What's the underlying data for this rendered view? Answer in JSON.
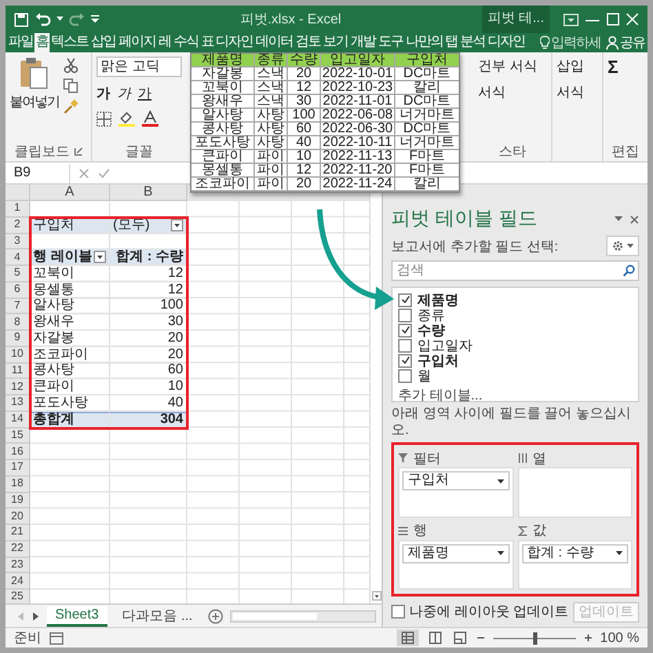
{
  "window": {
    "title": "피벗.xlsx - Excel",
    "context_tab": "피벗 테..."
  },
  "ribbon_tabs": [
    {
      "label": "파일",
      "selected": false
    },
    {
      "label": "홈",
      "selected": true
    },
    {
      "label": "텍스트",
      "selected": false
    },
    {
      "label": "삽입",
      "selected": false
    },
    {
      "label": "페이지 레",
      "selected": false
    },
    {
      "label": "수식",
      "selected": false
    },
    {
      "label": "표 디자인",
      "selected": false
    },
    {
      "label": "데이터",
      "selected": false
    },
    {
      "label": "검토",
      "selected": false
    },
    {
      "label": "보기",
      "selected": false
    },
    {
      "label": "개발 도구",
      "selected": false
    },
    {
      "label": "나만의 탭",
      "selected": false
    },
    {
      "label": "분석",
      "selected": false
    },
    {
      "label": "디자인",
      "selected": false
    }
  ],
  "tell_me": {
    "placeholder": "입력하세"
  },
  "share": "공유",
  "ribbon": {
    "clipboard": {
      "paste": "붙여넣기",
      "label": "클립보드"
    },
    "font": {
      "name": "맑은 고딕",
      "bold": "가",
      "italic": "가",
      "underline": "가",
      "label": "글꼴"
    },
    "styles": {
      "conditional": "건부 서식",
      "format": "서식",
      "label": "스타"
    },
    "cells": {
      "insert": "삽입",
      "format": "서식"
    },
    "editing": {
      "sum": "Σ",
      "label": "편집"
    }
  },
  "formula_bar": {
    "name_box": "B9"
  },
  "columns": [
    "A",
    "B"
  ],
  "sheet_rows": [
    {
      "num": "1"
    },
    {
      "num": "2",
      "kind": "filter",
      "a": "구입처",
      "b": "(모두)"
    },
    {
      "num": "3"
    },
    {
      "num": "4",
      "kind": "header",
      "a": "행 레이블",
      "b": "합계 : 수량"
    },
    {
      "num": "5",
      "kind": "item",
      "a": "꼬북이",
      "b": "12"
    },
    {
      "num": "6",
      "kind": "item",
      "a": "몽셀통",
      "b": "12"
    },
    {
      "num": "7",
      "kind": "item",
      "a": "알사탕",
      "b": "100"
    },
    {
      "num": "8",
      "kind": "item",
      "a": "왕새우",
      "b": "30"
    },
    {
      "num": "9",
      "kind": "item",
      "a": "자갈봉",
      "b": "20"
    },
    {
      "num": "10",
      "kind": "item",
      "a": "조코파이",
      "b": "20"
    },
    {
      "num": "11",
      "kind": "item",
      "a": "콩사탕",
      "b": "60"
    },
    {
      "num": "12",
      "kind": "item",
      "a": "큰파이",
      "b": "10"
    },
    {
      "num": "13",
      "kind": "item",
      "a": "포도사탕",
      "b": "40"
    },
    {
      "num": "14",
      "kind": "total",
      "a": "총합계",
      "b": "304"
    },
    {
      "num": "15"
    },
    {
      "num": "16"
    },
    {
      "num": "17"
    },
    {
      "num": "18"
    },
    {
      "num": "19"
    },
    {
      "num": "20"
    },
    {
      "num": "21"
    },
    {
      "num": "22"
    },
    {
      "num": "23"
    },
    {
      "num": "24"
    },
    {
      "num": "25"
    }
  ],
  "source_table": {
    "columns": [
      "제품명",
      "종류",
      "수량",
      "입고일자",
      "구입처"
    ],
    "rows": [
      [
        "자갈봉",
        "스낵",
        "20",
        "2022-10-01",
        "DC마트"
      ],
      [
        "꼬북이",
        "스낵",
        "12",
        "2022-10-23",
        "칼리"
      ],
      [
        "왕새우",
        "스낵",
        "30",
        "2022-11-01",
        "DC마트"
      ],
      [
        "알사탕",
        "사탕",
        "100",
        "2022-06-08",
        "너거마트"
      ],
      [
        "콩사탕",
        "사탕",
        "60",
        "2022-06-30",
        "DC마트"
      ],
      [
        "포도사탕",
        "사탕",
        "40",
        "2022-10-11",
        "너거마트"
      ],
      [
        "큰파이",
        "파이",
        "10",
        "2022-11-13",
        "F마트"
      ],
      [
        "몽셀통",
        "파이",
        "12",
        "2022-11-20",
        "F마트"
      ],
      [
        "조코파이",
        "파이",
        "20",
        "2022-11-24",
        "칼리"
      ]
    ]
  },
  "sheet_tabs": [
    {
      "label": "Sheet3",
      "selected": true
    },
    {
      "label": "다과모음 ...",
      "selected": false
    }
  ],
  "pivot_pane": {
    "title": "피벗 테이블 필드",
    "subtitle": "보고서에 추가할 필드 선택:",
    "search": {
      "placeholder": "검색"
    },
    "fields": [
      {
        "label": "제품명",
        "checked": true
      },
      {
        "label": "종류",
        "checked": false
      },
      {
        "label": "수량",
        "checked": true
      },
      {
        "label": "입고일자",
        "checked": false
      },
      {
        "label": "구입처",
        "checked": true
      },
      {
        "label": "월",
        "checked": false
      }
    ],
    "more_tables": "추가 테이블...",
    "instruction": "아래 영역 사이에 필드를 끌어 놓으십시오.",
    "areas": [
      {
        "kind": "filter",
        "label": "필터",
        "items": [
          "구입처"
        ]
      },
      {
        "kind": "columns",
        "label": "열"
      },
      {
        "kind": "rows",
        "label": "행",
        "items": [
          "제품명"
        ]
      },
      {
        "kind": "values",
        "label": "값",
        "items": [
          "합계 : 수량"
        ]
      }
    ],
    "defer": {
      "label": "나중에 레이아웃 업데이트",
      "checked": false
    },
    "update_button": {
      "label": "업데이트",
      "disabled": true
    }
  },
  "status_bar": {
    "status": "준비",
    "zoom": {
      "label": "100 %",
      "level": 0.5
    }
  }
}
